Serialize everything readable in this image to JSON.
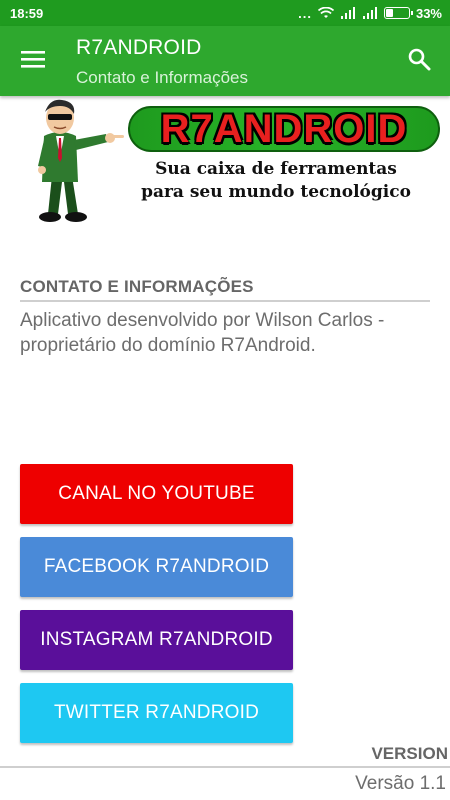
{
  "status_bar": {
    "time": "18:59",
    "dots": "...",
    "battery_percent": "33%",
    "battery_level": 0.33,
    "icons": [
      "signal-dots-icon",
      "wifi-icon",
      "cell-signal-icon",
      "cell-signal-icon",
      "battery-icon"
    ]
  },
  "app_bar": {
    "title": "R7ANDROID",
    "subtitle": "Contato e Informações",
    "menu_icon": "hamburger-menu-icon",
    "search_icon": "search-icon"
  },
  "banner": {
    "logo_text": "R7ANDROID",
    "tagline_line1": "Sua caixa de ferramentas",
    "tagline_line2": "para seu mundo tecnológico",
    "mascot": "mascot-illustration"
  },
  "contact_section": {
    "title": "CONTATO E INFORMAÇÕES",
    "body": "Aplicativo desenvolvido por Wilson Carlos - proprietário do domínio R7Android."
  },
  "buttons": {
    "youtube": {
      "label": "CANAL NO YOUTUBE",
      "color": "#ee0000"
    },
    "facebook": {
      "label": "FACEBOOK R7ANDROID",
      "color": "#4a8ad8"
    },
    "instagram": {
      "label": "INSTAGRAM R7ANDROID",
      "color": "#5a0f9a"
    },
    "twitter": {
      "label": "TWITTER R7ANDROID",
      "color": "#1ec8f2"
    }
  },
  "footer": {
    "version_label": "VERSION",
    "version_value": "Versão 1.1"
  },
  "colors": {
    "status_bar": "#1f9b1f",
    "app_bar": "#2ea82e",
    "muted_text": "#666666"
  }
}
